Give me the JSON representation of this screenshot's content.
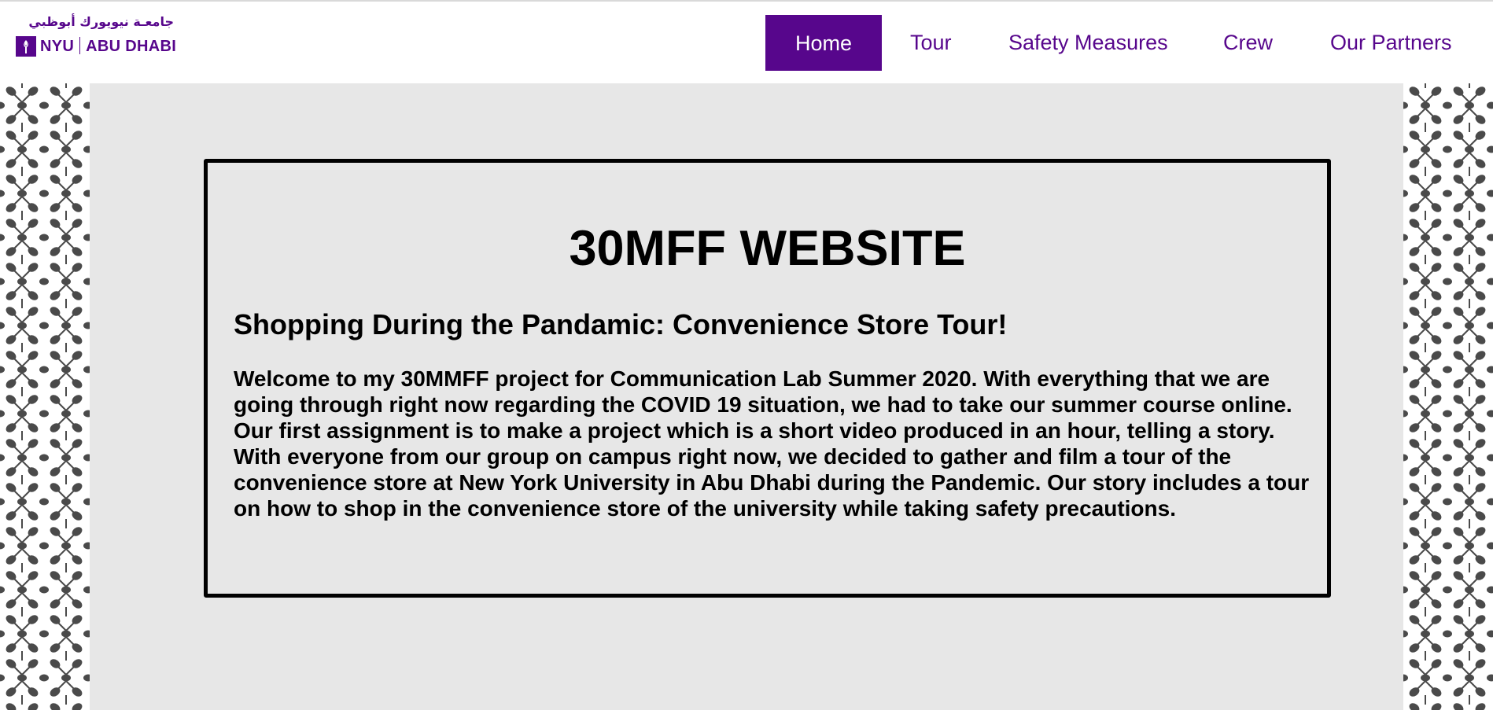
{
  "header": {
    "logo_arabic": "جامعـة نيويورك أبوظبي",
    "logo_nyu": "NYU",
    "logo_location": "ABU DHABI",
    "nav": [
      {
        "label": "Home",
        "active": true
      },
      {
        "label": "Tour",
        "active": false
      },
      {
        "label": "Safety Measures",
        "active": false
      },
      {
        "label": "Crew",
        "active": false
      },
      {
        "label": "Our Partners",
        "active": false
      }
    ]
  },
  "main": {
    "title": "30MFF WEBSITE",
    "subtitle": "Shopping During the Pandamic: Convenience Store Tour!",
    "intro": "Welcome to my 30MMFF project for Communication Lab Summer 2020. With everything that we are going through right now regarding the COVID 19 situation, we had to take our summer course online. Our first assignment is to make a project which is a short video produced in an hour, telling a story. With everyone from our group on campus right now, we decided to gather and film a tour of the convenience store at New York University in Abu Dhabi during the Pandemic. Our story includes a tour on how to shop in the convenience store of the university while taking safety precautions."
  },
  "colors": {
    "brand_purple": "#57068c",
    "content_background": "#e7e7e7",
    "border": "#000000",
    "pattern_dark": "#4a4a4a"
  },
  "icons": {
    "logo_mark": "nyu-torch-icon",
    "side_pattern": "torch-flower-pattern"
  }
}
